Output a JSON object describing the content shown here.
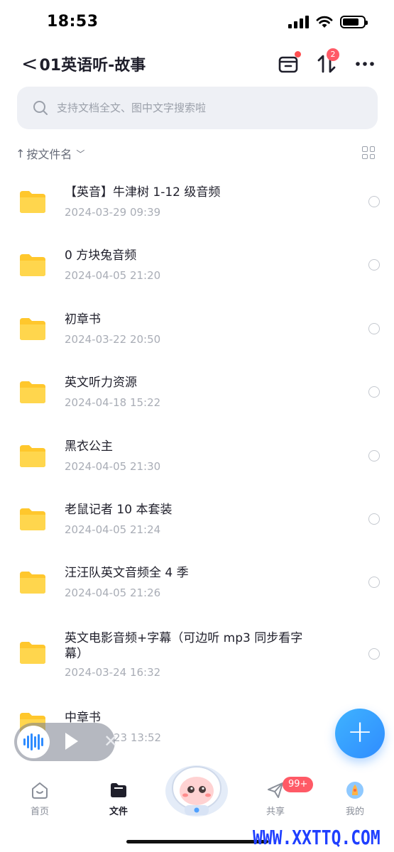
{
  "status_bar": {
    "time": "18:53"
  },
  "header": {
    "back_symbol": "<",
    "title": "01英语听-故事",
    "sort_badge": "2"
  },
  "search": {
    "placeholder": "支持文档全文、图中文字搜索啦"
  },
  "sort": {
    "arrow": "↑",
    "label": "按文件名",
    "chevron": "﹀"
  },
  "files": [
    {
      "name": "【英音】牛津树 1-12 级音频",
      "date": "2024-03-29 09:39"
    },
    {
      "name": "0 方块兔音频",
      "date": "2024-04-05 21:20"
    },
    {
      "name": "初章书",
      "date": "2024-03-22 20:50"
    },
    {
      "name": "英文听力资源",
      "date": "2024-04-18 15:22"
    },
    {
      "name": "黑衣公主",
      "date": "2024-04-05 21:30"
    },
    {
      "name": "老鼠记者 10 本套装",
      "date": "2024-04-05 21:24"
    },
    {
      "name": "汪汪队英文音频全 4 季",
      "date": "2024-04-05 21:26"
    },
    {
      "name": "英文电影音频+字幕（可边听 mp3 同步看字幕）",
      "date": "2024-03-24 16:32"
    },
    {
      "name": "中章书",
      "date": "23 13:52"
    }
  ],
  "fab": {
    "symbol": "+"
  },
  "player": {
    "close_symbol": "✕"
  },
  "tabs": [
    {
      "label": "首页",
      "icon": "home-face-icon"
    },
    {
      "label": "文件",
      "icon": "folder-icon"
    },
    {
      "label": "共享",
      "icon": "paper-plane-icon",
      "badge": "99+"
    },
    {
      "label": "我的",
      "icon": "avatar-icon"
    }
  ],
  "watermark": "WWW.XXTTQ.COM",
  "colors": {
    "accent": "#2f8cff",
    "badge": "#ff5a66",
    "folder": "#ffc72c",
    "watermark": "#1f3fff"
  }
}
